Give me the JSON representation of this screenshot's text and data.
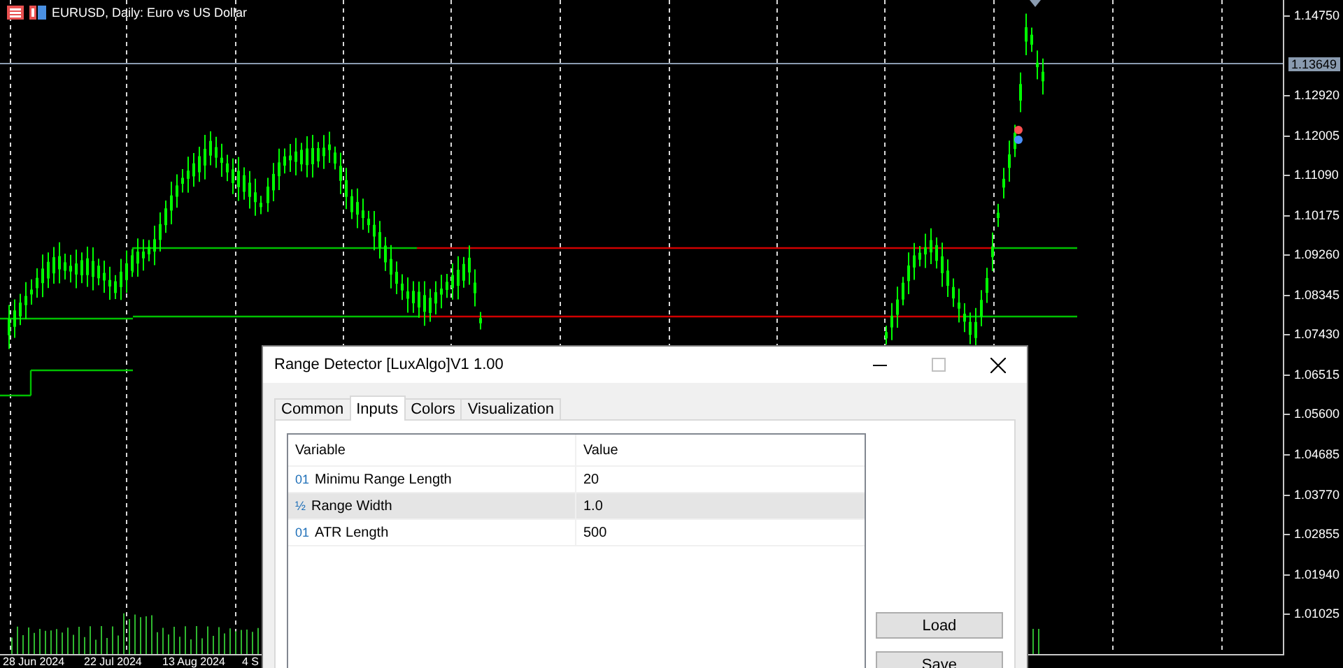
{
  "chart": {
    "title": "EURUSD, Daily:  Euro vs US Dollar",
    "price_labels": [
      "1.14750",
      "1.12920",
      "1.12005",
      "1.11090",
      "1.10175",
      "1.09260",
      "1.08345",
      "1.07430",
      "1.06515",
      "1.05600",
      "1.04685",
      "1.03770",
      "1.02855",
      "1.01940",
      "1.01025"
    ],
    "current_price": "1.13649",
    "date_labels": [
      "28 Jun 2024",
      "22 Jul 2024",
      "13 Aug 2024",
      "4 S"
    ]
  },
  "dialog": {
    "title": "Range Detector [LuxAlgo]V1 1.00",
    "tabs": [
      {
        "label": "Common",
        "selected": false
      },
      {
        "label": "Inputs",
        "selected": true
      },
      {
        "label": "Colors",
        "selected": false
      },
      {
        "label": "Visualization",
        "selected": false
      }
    ],
    "table": {
      "columns": [
        "Variable",
        "Value"
      ],
      "rows": [
        {
          "type_icon": "01",
          "variable": "Minimu Range Length",
          "value": "20",
          "selected": false
        },
        {
          "type_icon": "½",
          "variable": "Range Width",
          "value": "1.0",
          "selected": true
        },
        {
          "type_icon": "01",
          "variable": "ATR Length",
          "value": "500",
          "selected": false
        }
      ]
    },
    "buttons": [
      "Load",
      "Save"
    ]
  }
}
